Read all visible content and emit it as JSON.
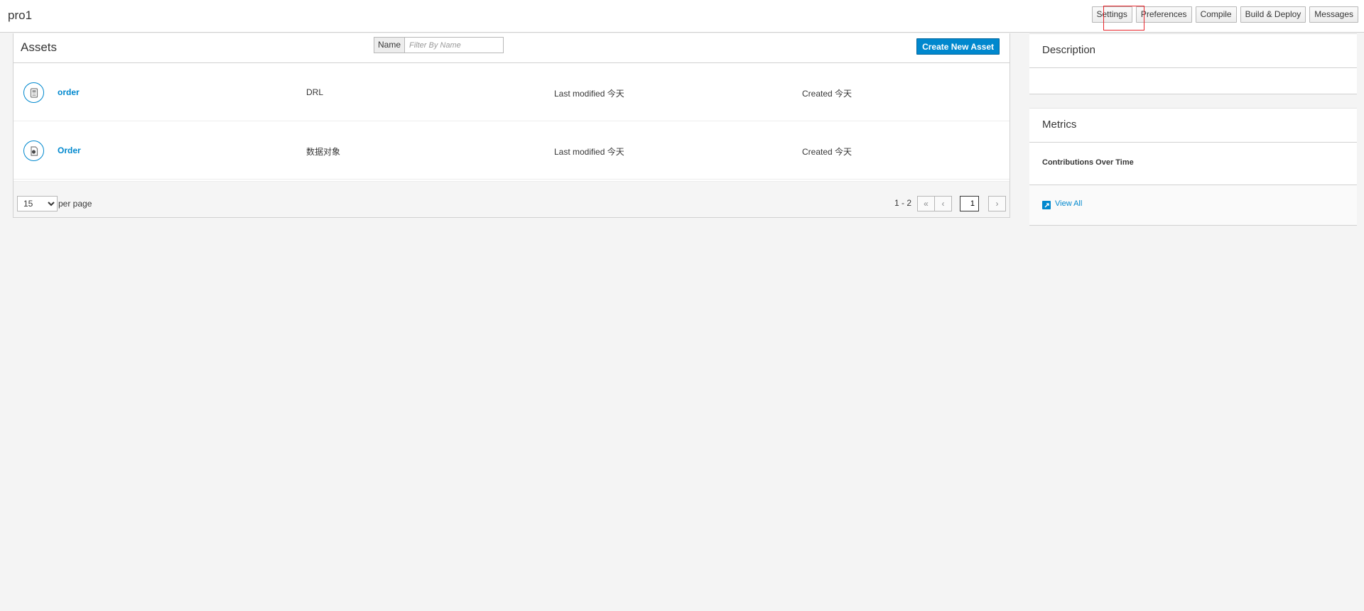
{
  "header": {
    "project_title": "pro1",
    "buttons": {
      "settings": "Settings",
      "preferences": "Preferences",
      "compile": "Compile",
      "build_deploy": "Build & Deploy",
      "messages": "Messages"
    }
  },
  "assets": {
    "title": "Assets",
    "filter_label": "Name",
    "filter_placeholder": "Filter By Name",
    "create_label": "Create New Asset",
    "rows": [
      {
        "name": "order",
        "type": "DRL",
        "modified": "Last modified 今天",
        "created": "Created 今天",
        "icon": "drl-file-icon"
      },
      {
        "name": "Order",
        "type": "数据对象",
        "modified": "Last modified 今天",
        "created": "Created 今天",
        "icon": "data-object-icon"
      }
    ],
    "pager": {
      "page_size": "15",
      "page_size_options": [
        "15"
      ],
      "per_page_label": "per page",
      "range": "1 - 2",
      "current_page": "1",
      "first_icon": "double-chevron-left-icon",
      "prev_icon": "chevron-left-icon",
      "next_icon": "chevron-right-icon"
    }
  },
  "sidebar": {
    "description_title": "Description",
    "metrics_title": "Metrics",
    "metrics_subtitle": "Contributions Over Time",
    "view_all_label": "View All"
  },
  "colors": {
    "accent": "#0088ce",
    "highlight": "#e8242a"
  }
}
